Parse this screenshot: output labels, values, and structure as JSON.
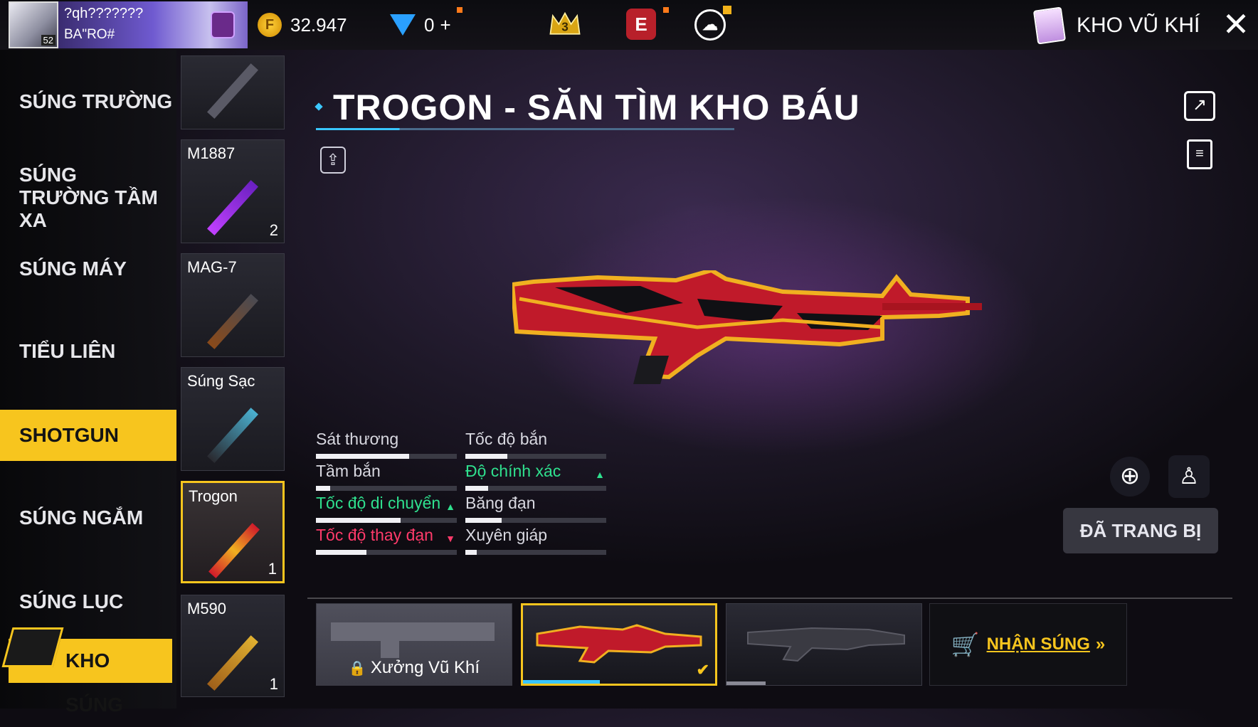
{
  "topbar": {
    "player_name": "?qh???????",
    "player_sub": "BA\"RO#",
    "level": "52",
    "gold": "32.947",
    "diamonds": "0",
    "diamond_add": "+",
    "rank_badge": "3",
    "elite_badge": "E",
    "screen_title": "KHO VŨ KHÍ",
    "close": "✕"
  },
  "categories": [
    {
      "label": "SÚNG TRƯỜNG",
      "active": false
    },
    {
      "label": "SÚNG TRƯỜNG TẦM XA",
      "active": false
    },
    {
      "label": "SÚNG MÁY",
      "active": false
    },
    {
      "label": "TIỂU LIÊN",
      "active": false
    },
    {
      "label": "SHOTGUN",
      "active": true
    },
    {
      "label": "SÚNG NGẮM",
      "active": false
    },
    {
      "label": "SÚNG LỤC",
      "active": false
    }
  ],
  "armory_button": "KHO SÚNG",
  "weapons": [
    {
      "name": "",
      "count": ""
    },
    {
      "name": "M1887",
      "count": "2"
    },
    {
      "name": "MAG-7",
      "count": ""
    },
    {
      "name": "Súng Sạc",
      "count": ""
    },
    {
      "name": "Trogon",
      "count": "1",
      "selected": true
    },
    {
      "name": "M590",
      "count": "1"
    }
  ],
  "gun": {
    "title": "TROGON - SĂN TÌM KHO BÁU"
  },
  "stats": [
    {
      "label": "Sát thương",
      "value": 0.66,
      "trend": "none"
    },
    {
      "label": "Tốc độ bắn",
      "value": 0.3,
      "trend": "none"
    },
    {
      "label": "Tầm bắn",
      "value": 0.1,
      "trend": "none"
    },
    {
      "label": "Độ chính xác",
      "value": 0.16,
      "trend": "up"
    },
    {
      "label": "Tốc độ di chuyển",
      "value": 0.6,
      "trend": "up"
    },
    {
      "label": "Băng đạn",
      "value": 0.26,
      "trend": "none"
    },
    {
      "label": "Tốc độ thay đạn",
      "value": 0.36,
      "trend": "down"
    },
    {
      "label": "Xuyên giáp",
      "value": 0.08,
      "trend": "none"
    }
  ],
  "equipped_label": "ĐÃ TRANG BỊ",
  "skins": {
    "workshop_label": "Xưởng Vũ Khí",
    "get_gun_label": "NHẬN SÚNG",
    "get_gun_arrow": "»"
  },
  "colors": {
    "accent": "#f7c51e",
    "stat_up": "#2fe08e",
    "stat_down": "#ff3a6a",
    "title_line": "#39c6ff"
  }
}
